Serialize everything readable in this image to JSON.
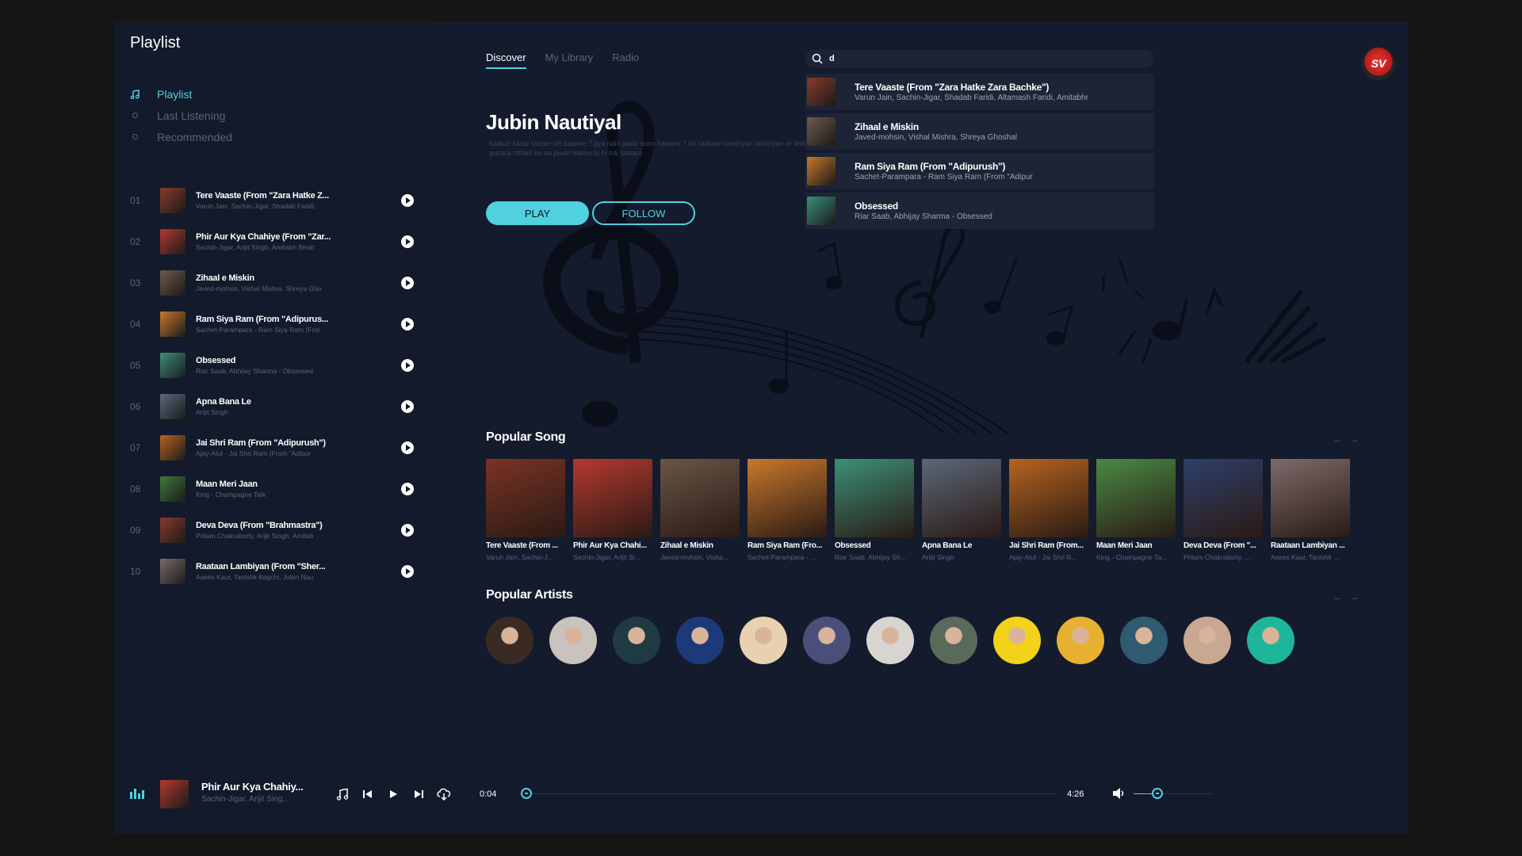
{
  "sidebar": {
    "title": "Playlist",
    "nav": [
      {
        "label": "Playlist",
        "active": true
      },
      {
        "label": "Last Listening",
        "active": false
      },
      {
        "label": "Recommended",
        "active": false
      }
    ],
    "tracks": [
      {
        "num": "01",
        "title": "Tere Vaaste (From \"Zara Hatke Z...",
        "artist": "Varun Jain, Sachin-Jigar, Shadab Faridi,",
        "color": "#8a3b2a"
      },
      {
        "num": "02",
        "title": "Phir Aur Kya Chahiye (From \"Zar...",
        "artist": "Sachin-Jigar, Arijit Singh, Amitabh Bhatt",
        "color": "#b2392f"
      },
      {
        "num": "03",
        "title": "Zihaal e Miskin",
        "artist": "Javed-mohsin, Vishal Mishra, Shreya Gho",
        "color": "#6e5a4a"
      },
      {
        "num": "04",
        "title": "Ram Siya Ram (From \"Adipurus...",
        "artist": "Sachet-Parampara - Ram Siya Ram (Fror",
        "color": "#c8782a"
      },
      {
        "num": "05",
        "title": "Obsessed",
        "artist": "Riar Saab, Abhijay Sharma - Obsessed",
        "color": "#3a8f7a"
      },
      {
        "num": "06",
        "title": "Apna Bana Le",
        "artist": "Arijit Singh",
        "color": "#5a6a7a"
      },
      {
        "num": "07",
        "title": "Jai Shri Ram (From \"Adipurush\")",
        "artist": "Ajay-Atul - Jai Shri Ram (From \"Adipur",
        "color": "#b8641e"
      },
      {
        "num": "08",
        "title": "Maan Meri Jaan",
        "artist": "King - Champagne Talk",
        "color": "#3f7a3a"
      },
      {
        "num": "09",
        "title": "Deva Deva (From \"Brahmastra\")",
        "artist": "Pritam Chakraborty, Arijit Singh, Amitab",
        "color": "#8a3a2f"
      },
      {
        "num": "10",
        "title": "Raataan Lambiyan (From \"Sher...",
        "artist": "Asees Kaur, Tanishk Bagchi, Jubin Nau",
        "color": "#7a6a6a"
      }
    ]
  },
  "main": {
    "tabs": [
      {
        "label": "Discover",
        "active": true
      },
      {
        "label": "My Library",
        "active": false
      },
      {
        "label": "Radio",
        "active": false
      }
    ],
    "hero": {
      "name": "Jubin Nautiyal",
      "lyrics": "kaatun kaise raatan oh saawre ? jiya nahi jaata sunn baawre ? ko raataan lambiyan lambiyan re tere bina mera howe na guzara chhad ke na jawin mainu tu hi hai sahara",
      "play_label": "PLAY",
      "follow_label": "FOLLOW"
    },
    "search": {
      "value": "d",
      "results": [
        {
          "title": "Tere Vaaste (From \"Zara Hatke Zara Bachke\")",
          "artist": "Varun Jain, Sachin-Jigar, Shadab Faridi, Altamash Faridi, Amitabhr",
          "color": "#8a3b2a"
        },
        {
          "title": "Zihaal e Miskin",
          "artist": "Javed-mohsin, Vishal Mishra, Shreya Ghoshal",
          "color": "#6e5a4a"
        },
        {
          "title": "Ram Siya Ram (From \"Adipurush\")",
          "artist": "Sachet-Parampara - Ram Siya Ram (From \"Adipur",
          "color": "#c8782a"
        },
        {
          "title": "Obsessed",
          "artist": "Riar Saab, Abhijay Sharma - Obsessed",
          "color": "#3a8f7a"
        }
      ]
    },
    "avatar_text": "SV",
    "popular_songs": {
      "title": "Popular Song",
      "items": [
        {
          "title": "Tere Vaaste (From ...",
          "artist": "Varun Jain, Sachin-J...",
          "color": "#7a3324"
        },
        {
          "title": "Phir Aur Kya Chahi...",
          "artist": "Sachin-Jigar, Arijit Si...",
          "color": "#b5392e"
        },
        {
          "title": "Zihaal e Miskin",
          "artist": "Javed-mohsin, Visha...",
          "color": "#6a5547"
        },
        {
          "title": "Ram Siya Ram (Fro...",
          "artist": "Sachet-Parampara - ...",
          "color": "#c9782c"
        },
        {
          "title": "Obsessed",
          "artist": "Riar Saab, Abhijay Sh...",
          "color": "#3b9077"
        },
        {
          "title": "Apna Bana Le",
          "artist": "Arijit Singh",
          "color": "#5b6778"
        },
        {
          "title": "Jai Shri Ram (From...",
          "artist": "Ajay-Atul - Jai Shri R...",
          "color": "#b5641f"
        },
        {
          "title": "Maan Meri Jaan",
          "artist": "King - Champagne Ta...",
          "color": "#4a8a43"
        },
        {
          "title": "Deva Deva (From \"...",
          "artist": "Pritam Chakraborty, ...",
          "color": "#2e3f6a"
        },
        {
          "title": "Raataan Lambiyan ...",
          "artist": "Asees Kaur, Tanishk ...",
          "color": "#7d6b6b"
        }
      ]
    },
    "popular_artists": {
      "title": "Popular Artists",
      "colors": [
        "#3a2a24",
        "#c9c2bd",
        "#1f3a40",
        "#1c3a7a",
        "#e8d0b0",
        "#4a4f7a",
        "#d8d4d0",
        "#5a6a5a",
        "#f2d21a",
        "#e8b030",
        "#2f5a70",
        "#c8a890",
        "#1fb59a"
      ]
    }
  },
  "player": {
    "title": "Phir Aur Kya Chahiy...",
    "artist": "Sachin-Jigar, Arijit Sing...",
    "cover_color": "#b5392e",
    "time_current": "0:04",
    "time_total": "4:26",
    "progress": 0.016,
    "volume": 0.3
  }
}
